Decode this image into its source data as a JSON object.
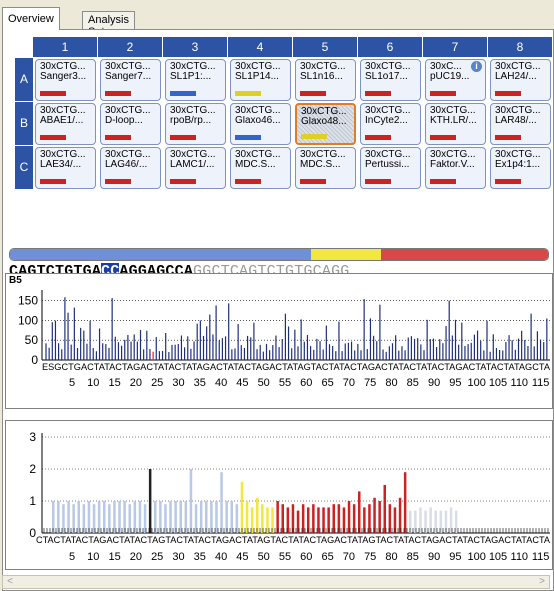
{
  "tabs": [
    {
      "label": "Overview",
      "active": true
    },
    {
      "label": "Analysis Setup",
      "active": false
    }
  ],
  "plate": {
    "columns": [
      "1",
      "2",
      "3",
      "4",
      "5",
      "6",
      "7",
      "8"
    ],
    "rows": [
      {
        "label": "A",
        "wells": [
          {
            "line1": "30xCTG...",
            "line2": "Sanger3...",
            "bar": "#cc2222"
          },
          {
            "line1": "30xCTG...",
            "line2": "Sanger7...",
            "bar": "#cc2222"
          },
          {
            "line1": "30xCTG...",
            "line2": "SL1P1:...",
            "bar": "#3366cc"
          },
          {
            "line1": "30xCTG...",
            "line2": "SL1P14...",
            "bar": "#e0d020"
          },
          {
            "line1": "30xCTG...",
            "line2": "SL1n16...",
            "bar": "#cc2222"
          },
          {
            "line1": "30xCTG...",
            "line2": "SL1o17...",
            "bar": "#cc2222"
          },
          {
            "line1": "30xC...",
            "line2": "pUC19...",
            "bar": "#cc2222",
            "info": "i"
          },
          {
            "line1": "30xCTG...",
            "line2": "LAH24/...",
            "bar": "#cc2222"
          }
        ]
      },
      {
        "label": "B",
        "wells": [
          {
            "line1": "30xCTG...",
            "line2": "ABAE1/...",
            "bar": "#cc2222"
          },
          {
            "line1": "30xCTG...",
            "line2": "D-loop...",
            "bar": "#cc2222"
          },
          {
            "line1": "30xCTG...",
            "line2": "rpoB/rp...",
            "bar": "#cc2222"
          },
          {
            "line1": "30xCTG...",
            "line2": "Glaxo46...",
            "bar": "#3366cc"
          },
          {
            "line1": "30xCTG...",
            "line2": "Glaxo48...",
            "bar": "#e0d020",
            "selected": true
          },
          {
            "line1": "30xCTG...",
            "line2": "InCyte2...",
            "bar": "#cc2222"
          },
          {
            "line1": "30xCTG...",
            "line2": "KTH.LR/...",
            "bar": "#cc2222"
          },
          {
            "line1": "30xCTG...",
            "line2": "LAR48/...",
            "bar": "#cc2222"
          }
        ]
      },
      {
        "label": "C",
        "wells": [
          {
            "line1": "30xCTG...",
            "line2": "LAE34/...",
            "bar": "#cc2222"
          },
          {
            "line1": "30xCTG...",
            "line2": "LAG46/...",
            "bar": "#cc2222"
          },
          {
            "line1": "30xCTG...",
            "line2": "LAMC1/...",
            "bar": "#cc2222"
          },
          {
            "line1": "30xCTG...",
            "line2": "MDC.S...",
            "bar": "#cc2222"
          },
          {
            "line1": "30xCTG...",
            "line2": "MDC.S...",
            "bar": "#cc2222"
          },
          {
            "line1": "30xCTG...",
            "line2": "Pertussi...",
            "bar": "#cc2222"
          },
          {
            "line1": "30xCTG...",
            "line2": "Faktor.V...",
            "bar": "#cc2222"
          },
          {
            "line1": "30xCTG...",
            "line2": "Ex1p4:1...",
            "bar": "#cc2222"
          }
        ]
      }
    ]
  },
  "sequence": {
    "colorbar": [
      {
        "color": "#6f8fd8",
        "fraction": 0.56
      },
      {
        "color": "#f2e640",
        "fraction": 0.13
      },
      {
        "color": "#d84848",
        "fraction": 0.31
      }
    ],
    "part1": "CAGTCTGTGA",
    "highlight": "CC",
    "part2": "AGGAGCCA",
    "part3": "GGCTCAGTCTGTGCAGG"
  },
  "chart_data": [
    {
      "type": "bar",
      "title": "B5",
      "ylim": [
        0,
        180
      ],
      "yticks": [
        0,
        50,
        100,
        150
      ],
      "xticks": [
        "5",
        "10",
        "15",
        "20",
        "25",
        "30",
        "35",
        "40",
        "45",
        "50",
        "55",
        "60",
        "65",
        "70",
        "75",
        "80",
        "85",
        "90",
        "95",
        "100",
        "105",
        "110",
        "115"
      ],
      "highlight_x": 20,
      "series_colors": {
        "normal": "#1e2f7a",
        "highlight": "#e02020"
      }
    },
    {
      "type": "bar",
      "ylim": [
        0,
        3
      ],
      "yticks": [
        0,
        1,
        2,
        3
      ],
      "xticks": [
        "5",
        "10",
        "15",
        "20",
        "25",
        "30",
        "35",
        "40",
        "45",
        "50",
        "55",
        "60",
        "65",
        "70",
        "75",
        "80",
        "85",
        "90",
        "95",
        "100",
        "105",
        "110",
        "115"
      ],
      "x": [
        1,
        2,
        3,
        4,
        5,
        6,
        7,
        8,
        9,
        10,
        11,
        12,
        13,
        14,
        15,
        16,
        17,
        18,
        19,
        20,
        21,
        22,
        23,
        24,
        25,
        26,
        27,
        28,
        29,
        30,
        31,
        32,
        33,
        34,
        35,
        36,
        37,
        38,
        39,
        40,
        41,
        42,
        43,
        44,
        45,
        46,
        47,
        48,
        49,
        50,
        51,
        52,
        53,
        54,
        55,
        56,
        57,
        58,
        59,
        60,
        61,
        62,
        63,
        64,
        65,
        66,
        67,
        68,
        69,
        70,
        71,
        72,
        73,
        74,
        75,
        76,
        77,
        78,
        79,
        80
      ],
      "values": [
        1.0,
        1.0,
        0.9,
        1.0,
        0.9,
        1.0,
        0.9,
        1.0,
        0.9,
        1.0,
        1.0,
        0.9,
        1.0,
        1.0,
        1.0,
        0.9,
        1.0,
        1.0,
        0.9,
        2.0,
        1.0,
        1.0,
        0.9,
        1.0,
        1.0,
        1.0,
        1.0,
        2.0,
        0.9,
        1.0,
        1.0,
        1.0,
        1.0,
        1.9,
        1.0,
        1.0,
        0.9,
        1.6,
        1.0,
        0.8,
        1.1,
        0.9,
        0.8,
        0.8,
        1.0,
        0.9,
        0.8,
        0.9,
        0.7,
        0.9,
        0.8,
        0.9,
        0.8,
        0.8,
        0.8,
        0.9,
        0.9,
        0.8,
        1.0,
        0.9,
        1.3,
        0.8,
        0.9,
        1.1,
        1.0,
        1.5,
        0.9,
        0.8,
        1.1,
        1.9,
        0.7,
        0.7,
        0.8,
        0.7,
        0.8,
        0.7,
        0.7,
        0.7,
        0.8,
        0.7
      ],
      "bar_colors": [
        "#b8c8e6",
        "#b8c8e6",
        "#b8c8e6",
        "#b8c8e6",
        "#b8c8e6",
        "#b8c8e6",
        "#b8c8e6",
        "#b8c8e6",
        "#b8c8e6",
        "#b8c8e6",
        "#b8c8e6",
        "#b8c8e6",
        "#b8c8e6",
        "#b8c8e6",
        "#b8c8e6",
        "#b8c8e6",
        "#b8c8e6",
        "#b8c8e6",
        "#b8c8e6",
        "#222222",
        "#b8c8e6",
        "#b8c8e6",
        "#b8c8e6",
        "#b8c8e6",
        "#b8c8e6",
        "#b8c8e6",
        "#b8c8e6",
        "#b8c8e6",
        "#b8c8e6",
        "#b8c8e6",
        "#b8c8e6",
        "#b8c8e6",
        "#b8c8e6",
        "#b8c8e6",
        "#b8c8e6",
        "#b8c8e6",
        "#b8c8e6",
        "#f2e640",
        "#f2e640",
        "#f2e640",
        "#f2e640",
        "#f2e640",
        "#f2e640",
        "#f2e640",
        "#cc2222",
        "#cc2222",
        "#cc2222",
        "#cc2222",
        "#cc2222",
        "#cc2222",
        "#cc2222",
        "#cc2222",
        "#cc2222",
        "#cc2222",
        "#cc2222",
        "#cc2222",
        "#cc2222",
        "#cc2222",
        "#cc2222",
        "#cc2222",
        "#cc2222",
        "#cc2222",
        "#cc2222",
        "#cc2222",
        "#cc2222",
        "#cc2222",
        "#cc2222",
        "#cc2222",
        "#cc2222",
        "#cc2222",
        "#d8dde8",
        "#d8dde8",
        "#d8dde8",
        "#d8dde8",
        "#d8dde8",
        "#d8dde8",
        "#d8dde8",
        "#d8dde8",
        "#d8dde8",
        "#d8dde8"
      ]
    }
  ],
  "scroll": {
    "left": "<",
    "right": ">"
  }
}
